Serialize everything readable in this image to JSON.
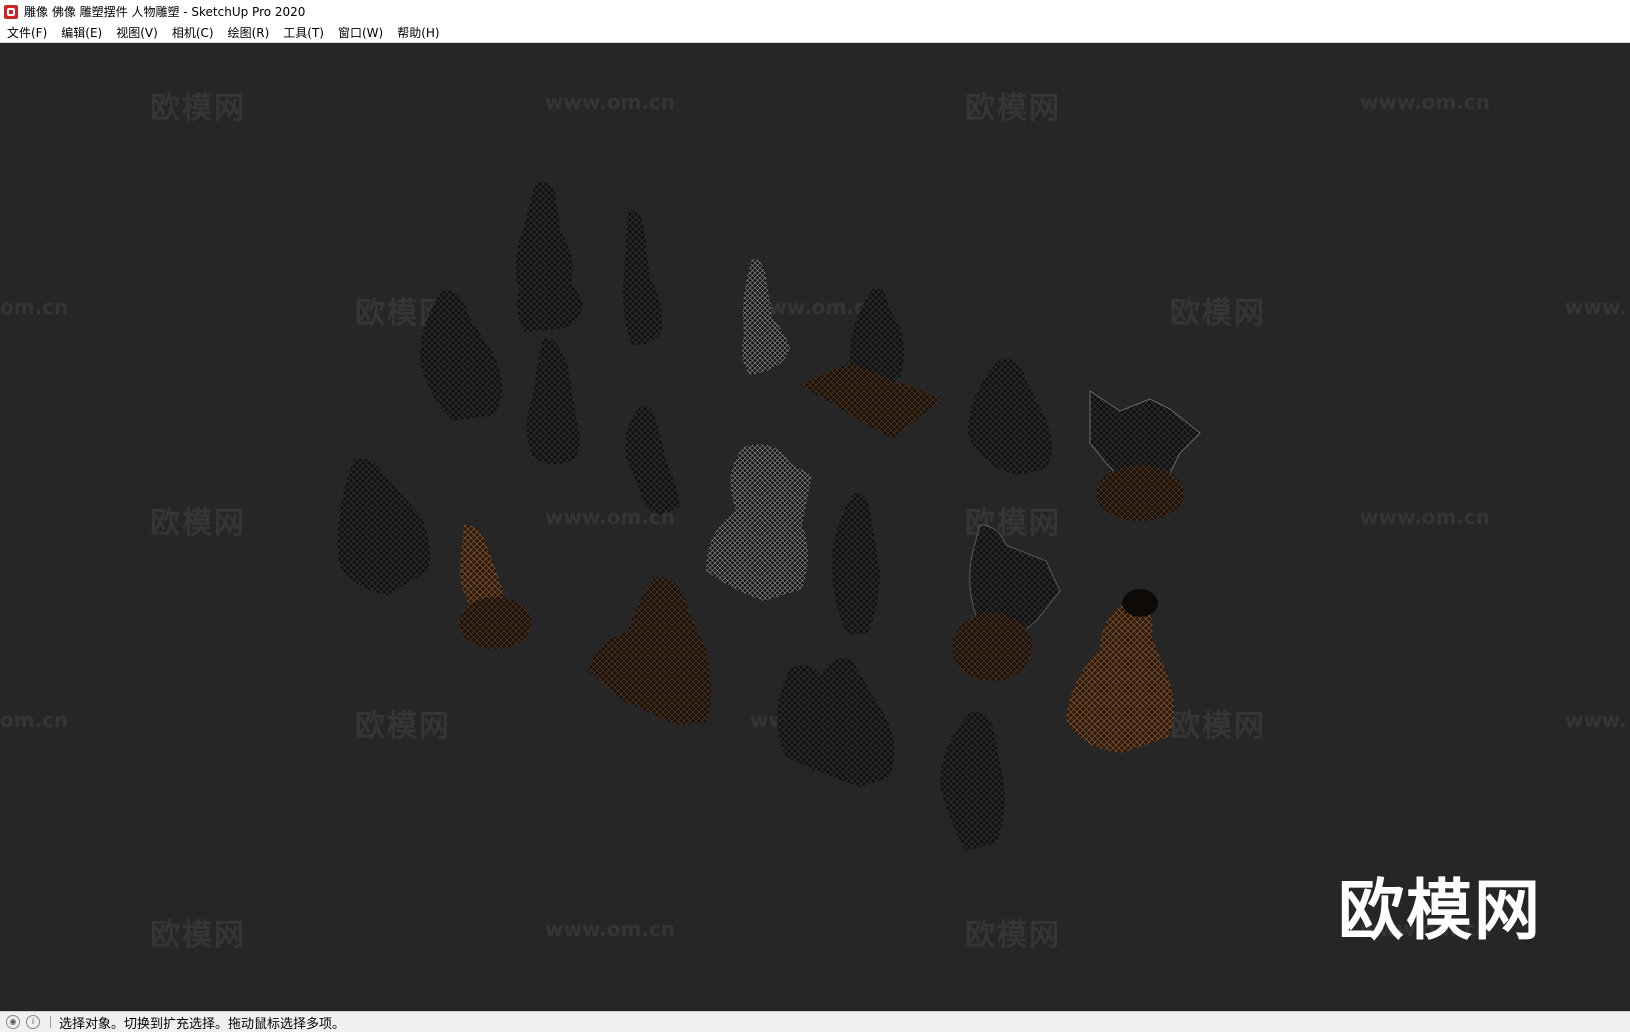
{
  "window": {
    "title": "雕像 佛像 雕塑摆件 人物雕塑 - SketchUp Pro 2020",
    "app_icon": "sketchup-icon"
  },
  "menu": {
    "items": [
      "文件(F)",
      "编辑(E)",
      "视图(V)",
      "相机(C)",
      "绘图(R)",
      "工具(T)",
      "窗口(W)",
      "帮助(H)"
    ]
  },
  "viewport": {
    "background": "#262626",
    "watermark_cn": "欧模网",
    "watermark_url": "www.om.cn",
    "watermark_url_cut_left": "om.cn",
    "watermark_url_cut_right": "www.",
    "logo": "欧模网"
  },
  "status": {
    "icons": [
      "geo-location-icon",
      "info-icon"
    ],
    "text": "选择对象。切换到扩充选择。拖动鼠标选择多项。"
  }
}
